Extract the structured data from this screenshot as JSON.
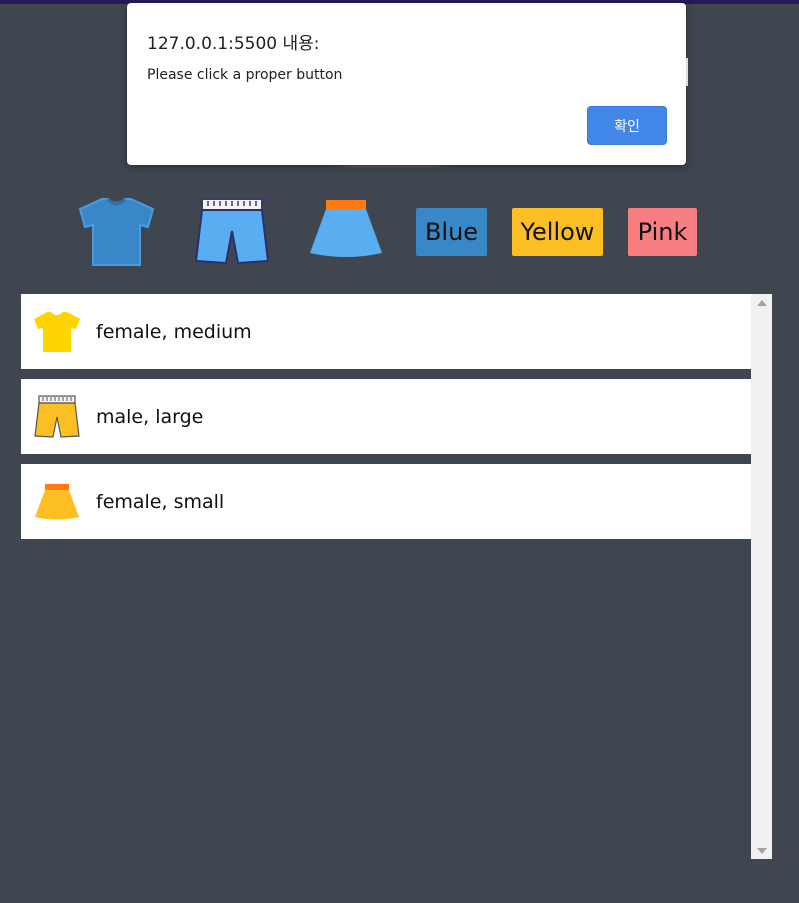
{
  "toolbar": {
    "icons": [
      "tshirt-icon",
      "shorts-icon",
      "skirt-icon"
    ],
    "color_buttons": [
      {
        "label": "Blue",
        "color": "#3a87c8"
      },
      {
        "label": "Yellow",
        "color": "#fbbf24"
      },
      {
        "label": "Pink",
        "color": "#f77f82"
      }
    ]
  },
  "items": [
    {
      "icon": "tshirt-icon",
      "color": "#ffd400",
      "label": "female, medium"
    },
    {
      "icon": "shorts-icon",
      "color": "#fbbf24",
      "label": "male, large"
    },
    {
      "icon": "skirt-icon",
      "color": "#fbbf24",
      "label": "female, small"
    }
  ],
  "dialog": {
    "title": "127.0.0.1:5500 내용:",
    "message": "Please click a proper button",
    "ok_label": "확인",
    "ok_color": "#4286e8"
  },
  "colors": {
    "background": "#3f4650",
    "top_strip": "#241b57",
    "blue_icon": "#3a87c8",
    "light_blue_icon": "#58aef0"
  }
}
